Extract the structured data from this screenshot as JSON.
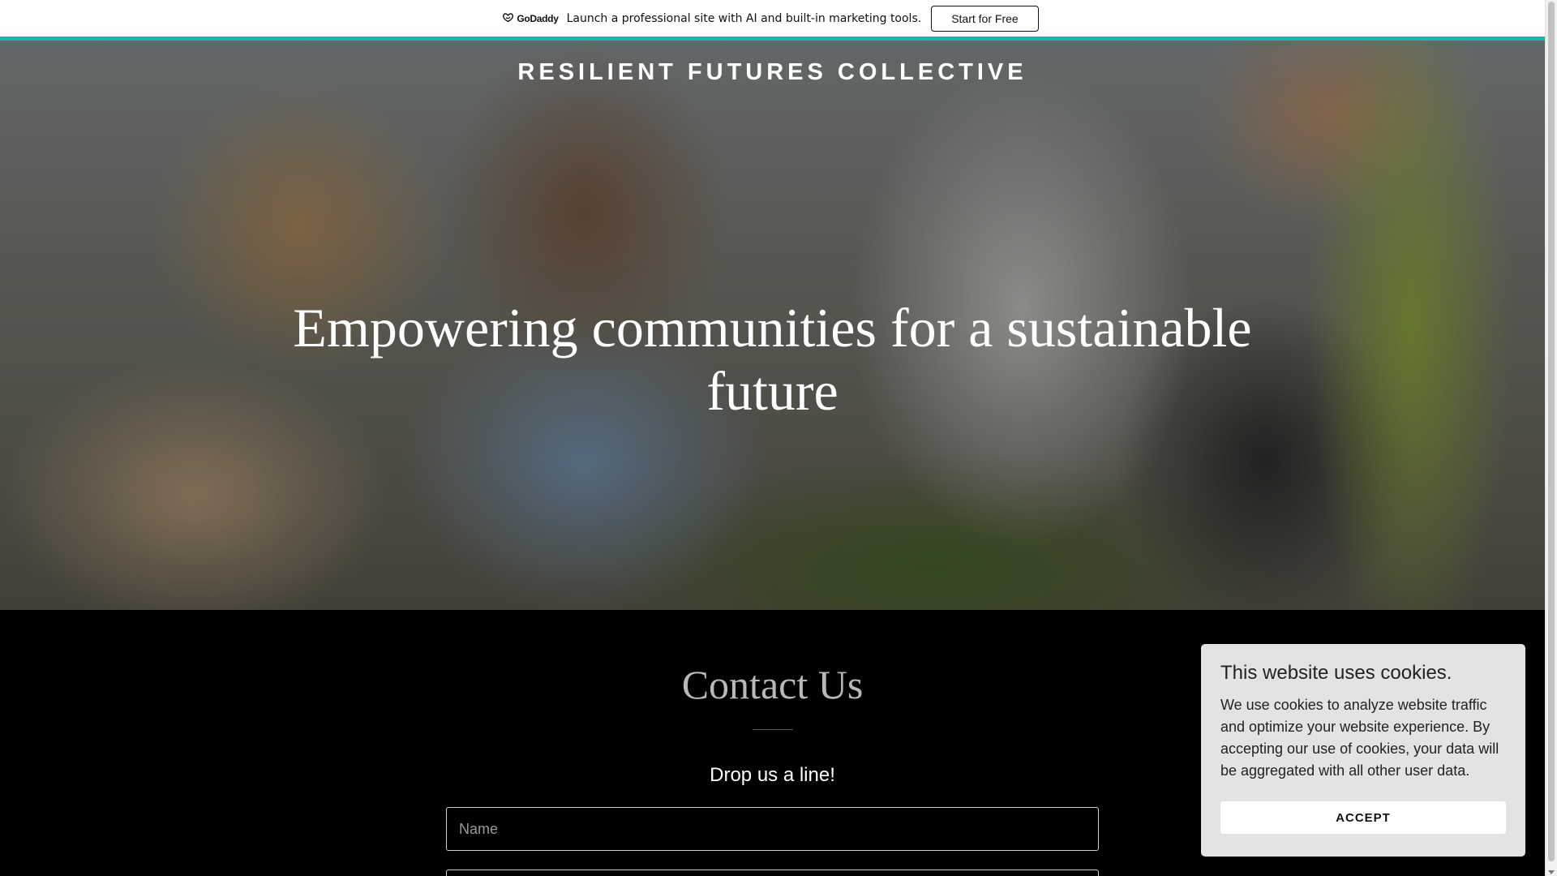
{
  "promo": {
    "brand": "GoDaddy",
    "text": "Launch a professional site with AI and built-in marketing tools.",
    "button_label": "Start for Free",
    "accent_color": "#1bb5b0"
  },
  "hero": {
    "site_title": "RESILIENT FUTURES COLLECTIVE",
    "heading": "Empowering communities for a sustainable future"
  },
  "contact": {
    "title": "Contact Us",
    "subtitle": "Drop us a line!",
    "name_placeholder": "Name"
  },
  "cookie_banner": {
    "title": "This website uses cookies.",
    "body": "We use cookies to analyze website traffic and optimize your website experience. By accepting our use of cookies, your data will be aggregated with all other user data.",
    "accept_label": "ACCEPT"
  },
  "icons": {
    "brand_logo": "godaddy-logo-icon"
  }
}
